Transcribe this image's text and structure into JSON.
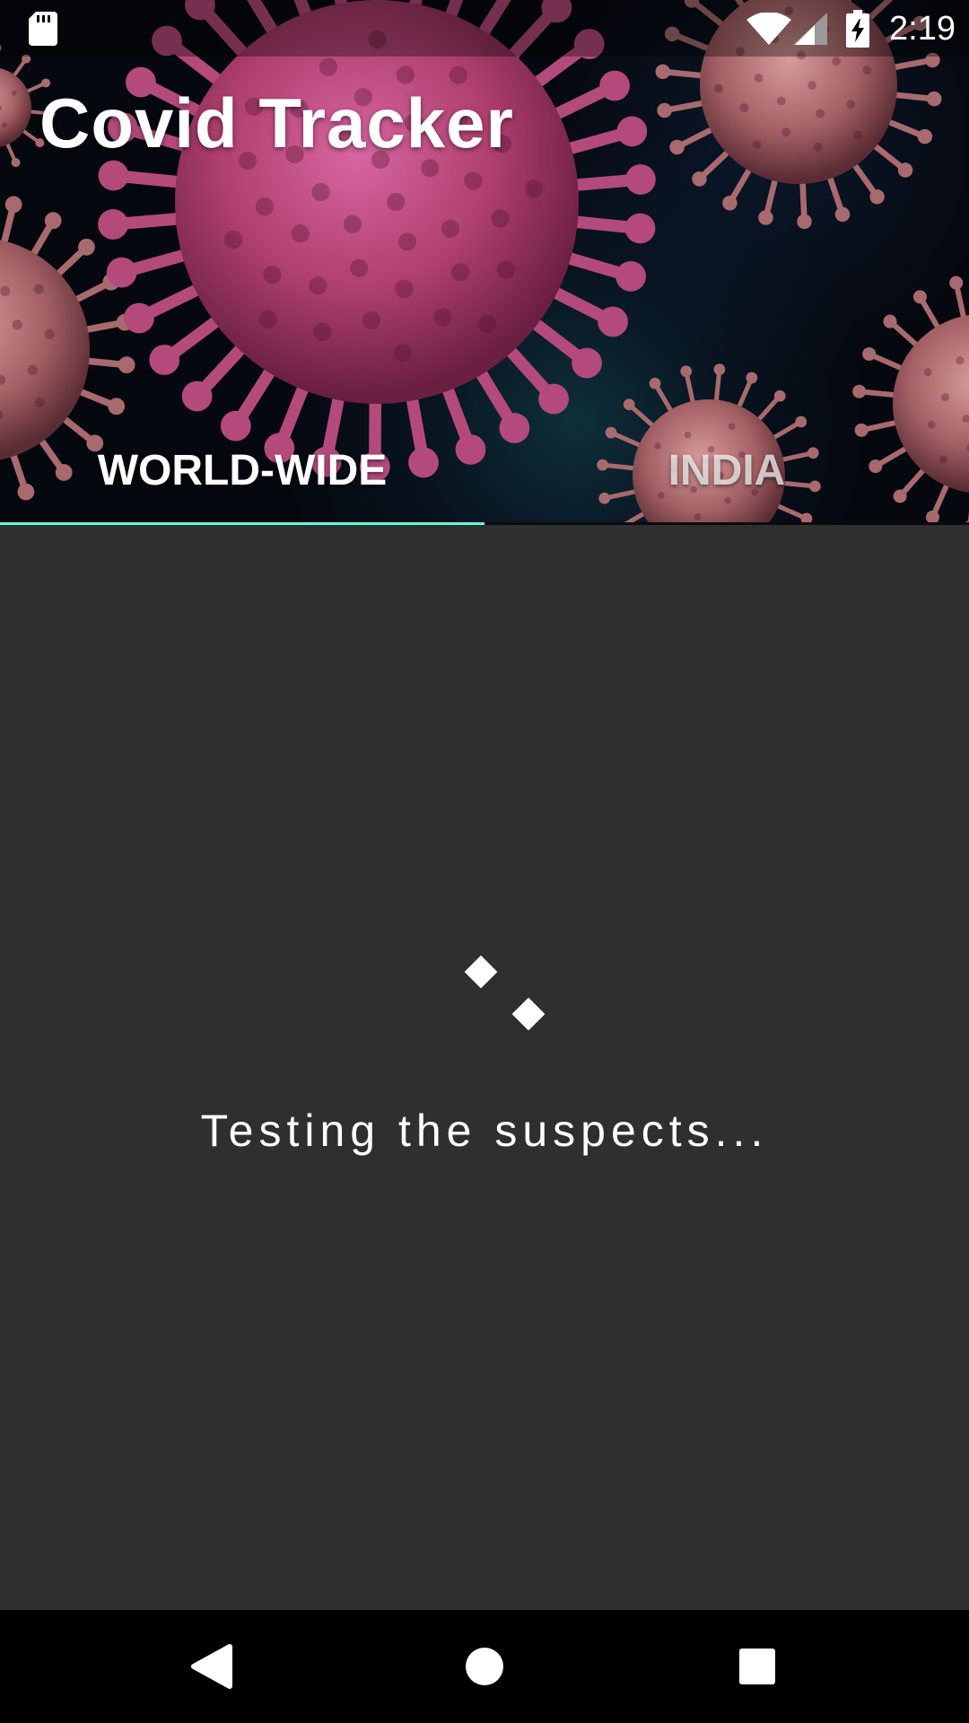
{
  "status_bar": {
    "time": "2:19",
    "icons": [
      "sd-card-icon",
      "wifi-icon",
      "cell-signal-icon",
      "battery-charging-icon"
    ]
  },
  "app": {
    "title": "Covid Tracker",
    "tabs": [
      {
        "label": "WORLD-WIDE",
        "selected": true
      },
      {
        "label": "INDIA",
        "selected": false
      }
    ]
  },
  "loading": {
    "message": "Testing the suspects..."
  },
  "nav_bar": {
    "icons": [
      "back-icon",
      "home-icon",
      "recents-icon"
    ]
  },
  "colors": {
    "background": "#2f2f2f",
    "tab_indicator": "#64ffda",
    "virus_pink": "#c2457d",
    "virus_muted": "#b06e72"
  }
}
